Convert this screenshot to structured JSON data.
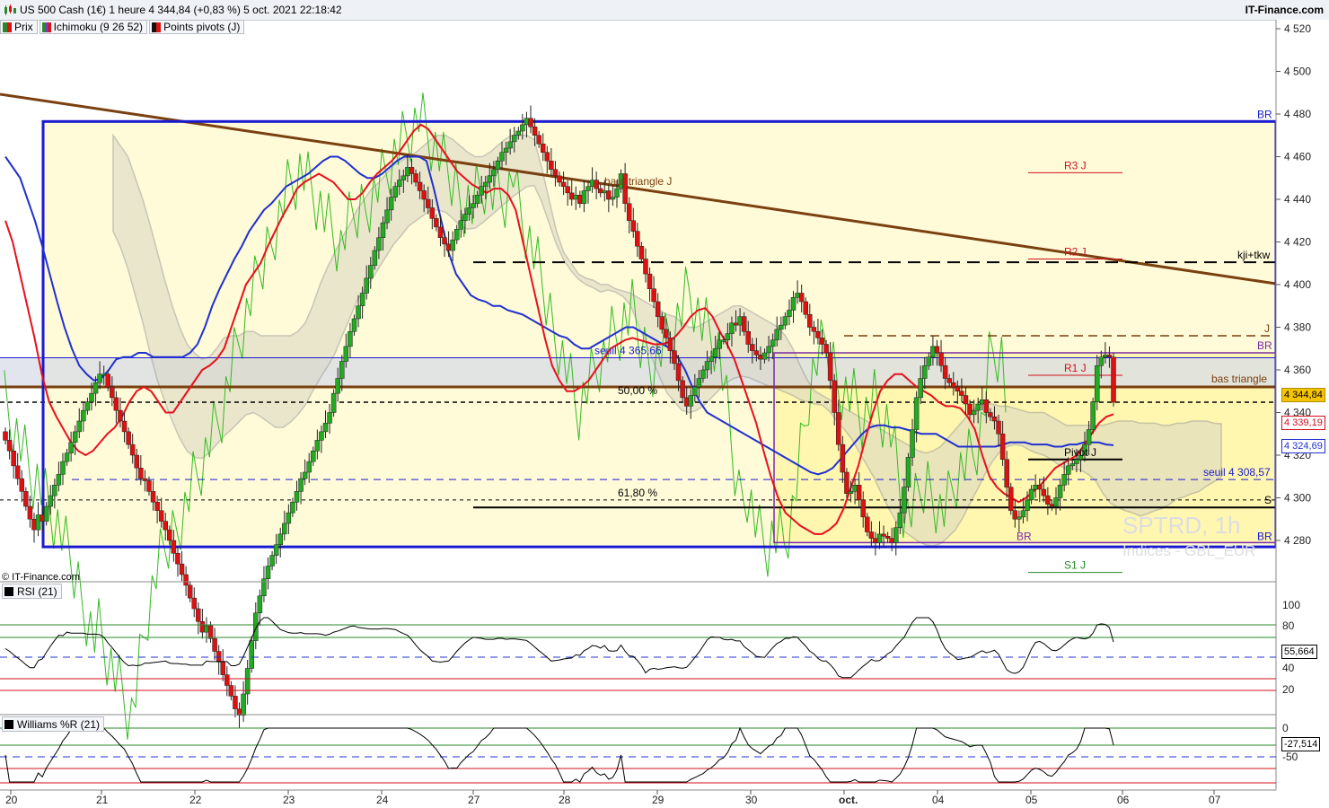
{
  "header": {
    "title": "US 500 Cash (1€) 1 heure 4 344,84 (+0,83 %) 5 oct. 2021 22:18:42",
    "brand": "IT-Finance.com"
  },
  "legend": [
    {
      "label": "Prix",
      "color": "#2a8a2a"
    },
    {
      "label": "Ichimoku (9 26 52)",
      "color": "#7a3cc8"
    },
    {
      "label": "Points pivots (J)",
      "color": "#6a3a10"
    }
  ],
  "copyright": "© IT-Finance.com",
  "watermark": {
    "line1": "SPTRD, 1h",
    "line2": "Indices - GBL_EUR"
  },
  "price_tags": [
    {
      "label": "4 344,84",
      "value": 4344.84,
      "bg": "#f5c400",
      "fg": "#000000",
      "border": "#b08a00"
    },
    {
      "label": "4 339,19",
      "value": 4339.19,
      "bg": "#ffffff",
      "fg": "#d0101e",
      "border": "#d0101e"
    },
    {
      "label": "4 324,69",
      "value": 4324.69,
      "bg": "#ffffff",
      "fg": "#2030d0",
      "border": "#2030d0"
    }
  ],
  "rsi": {
    "label": "RSI (21)",
    "value_label": "55,664",
    "ticks": [
      "100",
      "80",
      "40",
      "20"
    ]
  },
  "williams": {
    "label": "Williams %R (21)",
    "value_label": "-27,514",
    "ticks": [
      "0",
      "-50"
    ]
  },
  "chart_data": {
    "type": "candlestick",
    "title": "US 500 Cash (1€) 1 heure",
    "y_ticks": [
      4280,
      4300,
      4320,
      4340,
      4360,
      4380,
      4400,
      4420,
      4440,
      4460,
      4480,
      4500,
      4520
    ],
    "y_tick_labels": [
      "4 280",
      "4 300",
      "4 320",
      "4 340",
      "4 360",
      "4 380",
      "4 400",
      "4 420",
      "4 440",
      "4 460",
      "4 480",
      "4 500",
      "4 520"
    ],
    "ylim": [
      4267,
      4530
    ],
    "x_labels": [
      "20",
      "21",
      "22",
      "23",
      "24",
      "27",
      "28",
      "29",
      "30",
      "oct.",
      "04",
      "05",
      "06",
      "07"
    ],
    "grid": false,
    "colors": {
      "up": "#22aa22",
      "down": "#dd1111",
      "tenkan": "#e8101e",
      "kijun": "#2030d0",
      "chikou": "#33bb22",
      "trendline": "#7a4010",
      "box_blue": "#1a1ad0",
      "box_purple": "#7a2aa8",
      "cloud_edge": "#9a9a9a"
    },
    "closes": [
      4327,
      4322,
      4315,
      4309,
      4303,
      4296,
      4290,
      4285,
      4292,
      4289,
      4296,
      4301,
      4306,
      4311,
      4317,
      4321,
      4326,
      4331,
      4336,
      4341,
      4345,
      4349,
      4354,
      4358,
      4358,
      4352,
      4347,
      4341,
      4336,
      4331,
      4325,
      4320,
      4314,
      4309,
      4308,
      4303,
      4298,
      4294,
      4289,
      4285,
      4280,
      4274,
      4269,
      4264,
      4259,
      4253,
      4248,
      4242,
      4237,
      4240,
      4234,
      4228,
      4223,
      4217,
      4212,
      4207,
      4201,
      4198,
      4208,
      4220,
      4233,
      4246,
      4254,
      4262,
      4268,
      4273,
      4278,
      4283,
      4288,
      4293,
      4298,
      4303,
      4309,
      4312,
      4317,
      4322,
      4327,
      4331,
      4335,
      4340,
      4349,
      4356,
      4364,
      4371,
      4378,
      4384,
      4390,
      4396,
      4403,
      4409,
      4416,
      4422,
      4429,
      4435,
      4441,
      4446,
      4449,
      4451,
      4455,
      4452,
      4448,
      4444,
      4440,
      4436,
      4431,
      4427,
      4422,
      4419,
      4416,
      4421,
      4426,
      4430,
      4433,
      4436,
      4438,
      4442,
      4446,
      4448,
      4451,
      4454,
      4458,
      4462,
      4464,
      4467,
      4470,
      4472,
      4475,
      4478,
      4474,
      4470,
      4466,
      4462,
      4458,
      4454,
      4451,
      4448,
      4446,
      4443,
      4440,
      4442,
      4438,
      4444,
      4446,
      4449,
      4445,
      4443,
      4444,
      4440,
      4441,
      4445,
      4452,
      4438,
      4430,
      4425,
      4418,
      4412,
      4405,
      4398,
      4392,
      4385,
      4379,
      4375,
      4369,
      4363,
      4355,
      4347,
      4343,
      4348,
      4352,
      4356,
      4360,
      4364,
      4366,
      4370,
      4374,
      4374,
      4377,
      4382,
      4381,
      4385,
      4378,
      4372,
      4369,
      4367,
      4365,
      4368,
      4371,
      4374,
      4379,
      4381,
      4385,
      4388,
      4394,
      4396,
      4392,
      4386,
      4380,
      4378,
      4375,
      4372,
      4368,
      4355,
      4340,
      4325,
      4312,
      4302,
      4303,
      4306,
      4299,
      4291,
      4284,
      4281,
      4279,
      4283,
      4282,
      4281,
      4279,
      4286,
      4293,
      4305,
      4319,
      4332,
      4347,
      4356,
      4362,
      4366,
      4371,
      4368,
      4362,
      4356,
      4354,
      4352,
      4350,
      4348,
      4344,
      4339,
      4341,
      4344,
      4346,
      4340,
      4338,
      4336,
      4330,
      4318,
      4305,
      4294,
      4290,
      4291,
      4294,
      4299,
      4304,
      4306,
      4304,
      4301,
      4297,
      4296,
      4300,
      4306,
      4311,
      4315,
      4316,
      4318,
      4320,
      4325,
      4332,
      4345,
      4362,
      4366,
      4367,
      4366,
      4344.84
    ],
    "tenkan": [
      4430,
      4420,
      4405,
      4390,
      4375,
      4358,
      4345,
      4338,
      4332,
      4326,
      4322,
      4320,
      4322,
      4326,
      4330,
      4333,
      4338,
      4345,
      4350,
      4352,
      4350,
      4345,
      4340,
      4340,
      4345,
      4350,
      4355,
      4360,
      4362,
      4365,
      4370,
      4380,
      4390,
      4400,
      4405,
      4410,
      4418,
      4425,
      4432,
      4438,
      4445,
      4448,
      4450,
      4452,
      4450,
      4448,
      4444,
      4440,
      4440,
      4443,
      4448,
      4452,
      4455,
      4458,
      4462,
      4467,
      4472,
      4475,
      4473,
      4468,
      4463,
      4458,
      4453,
      4450,
      4447,
      4445,
      4443,
      4445,
      4445,
      4442,
      4435,
      4420,
      4405,
      4390,
      4375,
      4362,
      4355,
      4350,
      4350,
      4352,
      4355,
      4360,
      4365,
      4370,
      4372,
      4374,
      4375,
      4374,
      4373,
      4372,
      4372,
      4373,
      4376,
      4380,
      4385,
      4388,
      4389,
      4385,
      4378,
      4372,
      4365,
      4355,
      4345,
      4335,
      4322,
      4310,
      4300,
      4293,
      4290,
      4287,
      4285,
      4283,
      4283,
      4285,
      4288,
      4295,
      4305,
      4315,
      4328,
      4340,
      4350,
      4355,
      4358,
      4358,
      4355,
      4352,
      4350,
      4348,
      4345,
      4343,
      4343,
      4342,
      4338,
      4332,
      4320,
      4310,
      4305,
      4302,
      4300,
      4298,
      4300,
      4303,
      4306,
      4310,
      4314,
      4316,
      4318,
      4320,
      4325,
      4330,
      4335,
      4338,
      4339.19
    ],
    "kijun": [
      4460,
      4455,
      4450,
      4440,
      4430,
      4418,
      4405,
      4392,
      4380,
      4370,
      4362,
      4358,
      4355,
      4356,
      4360,
      4365,
      4366,
      4366,
      4368,
      4368,
      4366,
      4366,
      4366,
      4366,
      4366,
      4368,
      4372,
      4380,
      4390,
      4398,
      4405,
      4412,
      4418,
      4425,
      4430,
      4435,
      4438,
      4442,
      4446,
      4448,
      4450,
      4452,
      4455,
      4458,
      4460,
      4460,
      4458,
      4455,
      4452,
      4450,
      4450,
      4452,
      4455,
      4458,
      4460,
      4460,
      4460,
      4458,
      4445,
      4430,
      4415,
      4405,
      4400,
      4395,
      4393,
      4392,
      4390,
      4390,
      4388,
      4387,
      4386,
      4384,
      4382,
      4380,
      4378,
      4376,
      4375,
      4372,
      4370,
      4370,
      4372,
      4374,
      4376,
      4378,
      4380,
      4380,
      4378,
      4376,
      4374,
      4372,
      4370,
      4366,
      4360,
      4352,
      4345,
      4340,
      4338,
      4336,
      4334,
      4332,
      4330,
      4328,
      4326,
      4324,
      4322,
      4320,
      4318,
      4316,
      4314,
      4312,
      4311,
      4312,
      4314,
      4318,
      4322,
      4326,
      4330,
      4333,
      4334,
      4334,
      4333,
      4333,
      4332,
      4331,
      4330,
      4330,
      4330,
      4328,
      4326,
      4324,
      4324,
      4324,
      4324,
      4324,
      4324,
      4325,
      4326,
      4326,
      4326,
      4325,
      4325,
      4325,
      4324,
      4324,
      4325,
      4325,
      4326,
      4326,
      4326,
      4325,
      4324.69
    ],
    "levels": [
      {
        "label": "BR",
        "value": 4476.5,
        "color": "#1a1ad0"
      },
      {
        "label": "R3 J",
        "value": 4452.5,
        "color": "#d0101e"
      },
      {
        "label": "haut triangle J",
        "value": 4450,
        "color": "#7a4010"
      },
      {
        "label": "R2 J",
        "value": 4412,
        "color": "#d0101e"
      },
      {
        "label": "kji+tkw",
        "value": 4410.5,
        "color": "#000000"
      },
      {
        "label": "J",
        "value": 4376,
        "color": "#7a4010"
      },
      {
        "label": "BR",
        "value": 4368,
        "color": "#7a2aa8"
      },
      {
        "label": "seuil 4 365,66",
        "value": 4365.66,
        "color": "#1a1ad0"
      },
      {
        "label": "R1 J",
        "value": 4357.5,
        "color": "#d0101e"
      },
      {
        "label": "bas triangle",
        "value": 4352,
        "color": "#7a4010"
      },
      {
        "label": "50,00 %",
        "value": 4349,
        "color": "#000000"
      },
      {
        "label": "Pivot J",
        "value": 4318,
        "color": "#000000"
      },
      {
        "label": "seuil 4 308,57",
        "value": 4308.57,
        "color": "#1a1ad0"
      },
      {
        "label": "61,80 %",
        "value": 4299,
        "color": "#000000"
      },
      {
        "label": "S",
        "value": 4295.5,
        "color": "#000000"
      },
      {
        "label": "BR",
        "value": 4279,
        "color": "#7a2aa8"
      },
      {
        "label": "BR",
        "value": 4277,
        "color": "#1a1ad0"
      },
      {
        "label": "S1 J",
        "value": 4265,
        "color": "#2a8a2a"
      }
    ]
  }
}
